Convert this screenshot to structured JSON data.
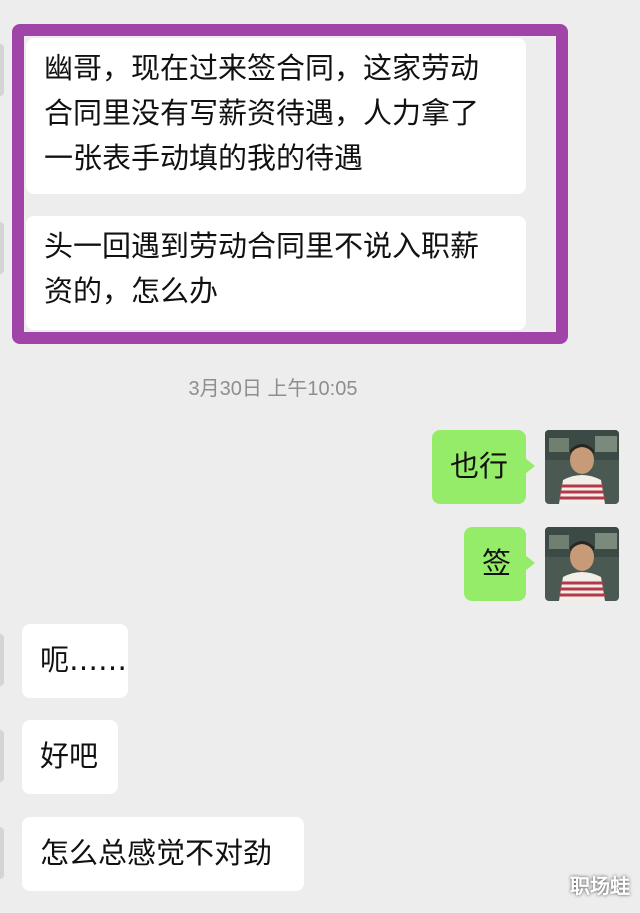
{
  "messages": {
    "m1_line1": "幽哥，现在过来签合同，这家劳动",
    "m1_line2": "合同里没有写薪资待遇，人力拿了",
    "m1_line3": "一张表手动填的我的待遇",
    "m2_line1": "头一回遇到劳动合同里不说入职薪",
    "m2_line2": "资的，怎么办",
    "timestamp": "3月30日 上午10:05",
    "m3": "也行",
    "m4": "签",
    "m5": "呃……",
    "m6": "好吧",
    "m7": "怎么总感觉不对劲"
  },
  "watermark": "职场蛙",
  "colors": {
    "highlight": "#a044a8",
    "outgoing_bubble": "#95ec69",
    "incoming_bubble": "#ffffff",
    "background": "#ededed"
  }
}
